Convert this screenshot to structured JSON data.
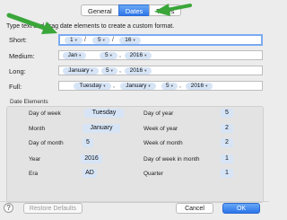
{
  "tabs": [
    {
      "label": "General",
      "selected": false
    },
    {
      "label": "Dates",
      "selected": true
    },
    {
      "label": "Times",
      "selected": false
    }
  ],
  "instructions": "Type text and drag date elements to create a custom format.",
  "formats": {
    "short": {
      "label": "Short:",
      "tokens": [
        "1",
        "5",
        "16"
      ]
    },
    "medium": {
      "label": "Medium:",
      "tokens": [
        "Jan",
        "5",
        "2016"
      ]
    },
    "long": {
      "label": "Long:",
      "tokens": [
        "January",
        "5",
        "2016"
      ]
    },
    "full": {
      "label": "Full:",
      "tokens": [
        "Tuesday",
        "January",
        "5",
        "2016"
      ]
    }
  },
  "date_elements": {
    "title": "Date Elements",
    "left": [
      {
        "label": "Day of week",
        "value": "Tuesday"
      },
      {
        "label": "Month",
        "value": "January"
      },
      {
        "label": "Day of month",
        "value": "5"
      },
      {
        "label": "Year",
        "value": "2016"
      },
      {
        "label": "Era",
        "value": "AD"
      }
    ],
    "right": [
      {
        "label": "Day of year",
        "value": "5"
      },
      {
        "label": "Week of year",
        "value": "2"
      },
      {
        "label": "Week of month",
        "value": "2"
      },
      {
        "label": "Day of week in month",
        "value": "1"
      },
      {
        "label": "Quarter",
        "value": "1"
      }
    ]
  },
  "buttons": {
    "help": "?",
    "restore": "Restore Defaults",
    "cancel": "Cancel",
    "ok": "OK"
  },
  "colors": {
    "accent": "#2f78ea",
    "token_bg": "#d6e4f6",
    "arrow": "#3aa63a"
  }
}
